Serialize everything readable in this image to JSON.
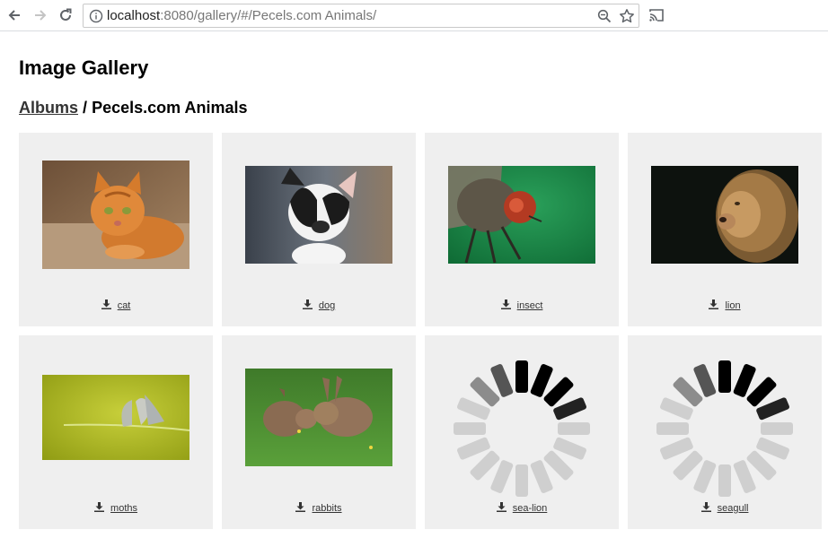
{
  "browser": {
    "url_host": "localhost",
    "url_rest": ":8080/gallery/#/Pecels.com Animals/"
  },
  "page": {
    "title": "Image Gallery",
    "breadcrumb": {
      "albums_label": "Albums",
      "separator": "/",
      "current": "Pecels.com Animals"
    }
  },
  "gallery": {
    "items": [
      {
        "name": "cat",
        "state": "loaded"
      },
      {
        "name": "dog",
        "state": "loaded"
      },
      {
        "name": "insect",
        "state": "loaded"
      },
      {
        "name": "lion",
        "state": "loaded"
      },
      {
        "name": "moths",
        "state": "loaded"
      },
      {
        "name": "rabbits",
        "state": "loaded"
      },
      {
        "name": "sea-lion",
        "state": "loading"
      },
      {
        "name": "seagull",
        "state": "loading"
      }
    ]
  },
  "icons": {
    "back": "arrow-left-icon",
    "forward": "arrow-right-icon",
    "reload": "reload-icon",
    "info": "info-icon",
    "zoom": "zoom-icon",
    "bookmark": "star-icon",
    "cast": "cast-icon",
    "download": "download-icon",
    "loading": "loading-spinner-icon"
  },
  "colors": {
    "card_background": "#efefef",
    "link_text": "#333333"
  }
}
